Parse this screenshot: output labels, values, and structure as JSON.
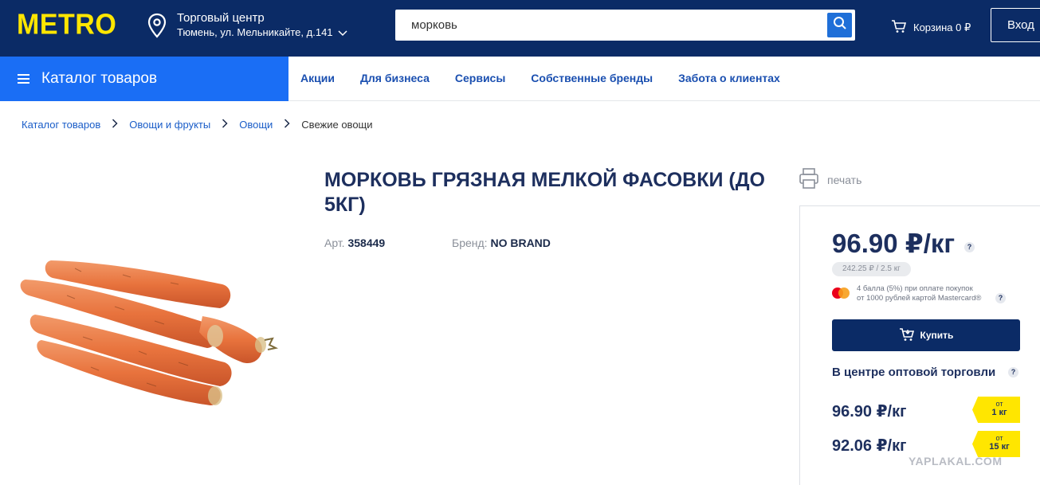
{
  "header": {
    "logo": "METRO",
    "store_name": "Торговый центр",
    "store_address": "Тюмень, ул. Мельникайте, д.141",
    "search_value": "морковь",
    "cart_label": "Корзина 0 ₽",
    "login_label": "Вход",
    "brand_color": "#0b2b66",
    "logo_color": "#ffe600"
  },
  "nav": {
    "catalog_label": "Каталог товаров",
    "links": [
      "Акции",
      "Для бизнеса",
      "Сервисы",
      "Собственные бренды",
      "Забота о клиентах"
    ]
  },
  "breadcrumb": {
    "items": [
      "Каталог товаров",
      "Овощи и фрукты",
      "Овощи"
    ],
    "current": "Свежие овощи"
  },
  "product": {
    "title": "МОРКОВЬ ГРЯЗНАЯ МЕЛКОЙ ФАСОВКИ (ДО 5КГ)",
    "art_label": "Арт.",
    "art_value": "358449",
    "brand_label": "Бренд:",
    "brand_value": "NO BRAND",
    "print_label": "печать"
  },
  "price": {
    "main": "96.90 ₽/кг",
    "pack": "242.25 ₽ / 2.5 кг",
    "mastercard_line1": "4 балла (5%) при оплате покупок",
    "mastercard_line2": "от 1000 рублей картой Mastercard®",
    "buy_label": "Купить",
    "wholesale_title": "В центре оптовой торговли",
    "tiers": [
      {
        "price": "96.90 ₽/кг",
        "from": "от",
        "qty": "1 кг"
      },
      {
        "price": "92.06 ₽/кг",
        "from": "от",
        "qty": "15 кг"
      }
    ]
  },
  "watermark": "YAPLAKAL.COM"
}
